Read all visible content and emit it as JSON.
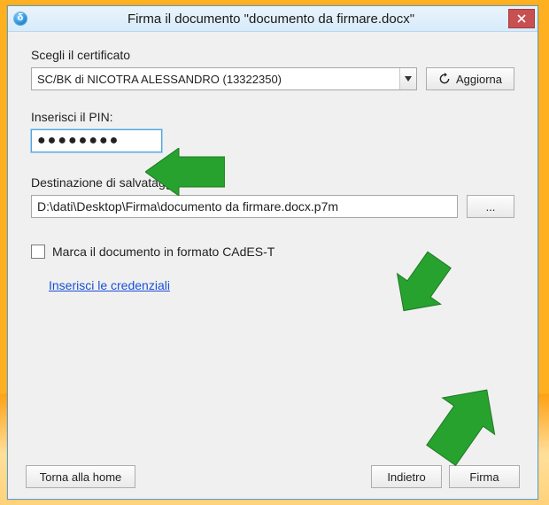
{
  "window": {
    "title": "Firma il documento \"documento da firmare.docx\""
  },
  "cert": {
    "label": "Scegli il certificato",
    "selected": "SC/BK di NICOTRA ALESSANDRO (13322350)",
    "refresh": "Aggiorna"
  },
  "pin": {
    "label": "Inserisci il PIN:",
    "value": "●●●●●●●●"
  },
  "dest": {
    "label": "Destinazione di salvataggio:",
    "path": "D:\\dati\\Desktop\\Firma\\documento da firmare.docx.p7m",
    "browse": "..."
  },
  "marca": {
    "label": "Marca il documento in formato CAdES-T"
  },
  "cred_link": "Inserisci le credenziali",
  "footer": {
    "home": "Torna alla home",
    "back": "Indietro",
    "sign": "Firma"
  }
}
